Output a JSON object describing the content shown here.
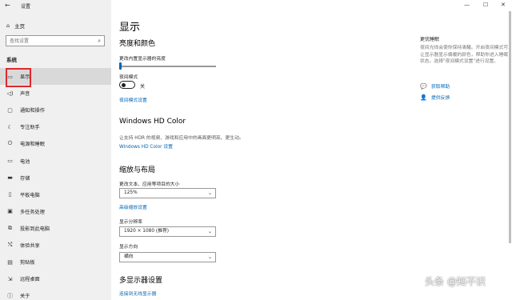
{
  "window": {
    "title": "设置",
    "back_icon": "arrow-left-icon",
    "controls": [
      "—",
      "☐",
      "✕"
    ]
  },
  "sidebar": {
    "home_label": "主页",
    "search_placeholder": "查找设置",
    "section": "系统",
    "items": [
      {
        "label": "显示",
        "icon": "monitor-icon",
        "active": true
      },
      {
        "label": "声音",
        "icon": "speaker-icon"
      },
      {
        "label": "通知和操作",
        "icon": "notification-icon"
      },
      {
        "label": "专注助手",
        "icon": "moon-icon"
      },
      {
        "label": "电源和睡眠",
        "icon": "power-icon"
      },
      {
        "label": "电池",
        "icon": "battery-icon"
      },
      {
        "label": "存储",
        "icon": "storage-icon"
      },
      {
        "label": "平板电脑",
        "icon": "tablet-icon"
      },
      {
        "label": "多任务处理",
        "icon": "multitask-icon"
      },
      {
        "label": "投影到此电脑",
        "icon": "project-icon"
      },
      {
        "label": "体验共享",
        "icon": "share-icon"
      },
      {
        "label": "剪贴板",
        "icon": "clipboard-icon"
      },
      {
        "label": "远程桌面",
        "icon": "remote-desktop-icon"
      },
      {
        "label": "关于",
        "icon": "info-icon"
      }
    ]
  },
  "main": {
    "title": "显示",
    "brightness": {
      "heading": "亮度和颜色",
      "slider_label": "更改内置显示器的亮度",
      "slider_level": 0.0,
      "night_light_label": "夜间模式",
      "night_light_state": "关",
      "night_light_link": "夜间模式设置"
    },
    "hdr": {
      "heading": "Windows HD Color",
      "desc": "让支持 HDR 的视频、游戏和应用中的画面更明亮、更生动。",
      "link": "Windows HD Color 设置"
    },
    "scale": {
      "heading": "缩放与布局",
      "text_size_label": "更改文本、应用等项目的大小",
      "text_size_value": "125%",
      "advanced_link": "高级缩放设置",
      "resolution_label": "显示分辨率",
      "resolution_value": "1920 × 1080 (推荐)",
      "orientation_label": "显示方向",
      "orientation_value": "横向"
    },
    "multi": {
      "heading": "多显示器设置",
      "link": "连接到无线显示器"
    }
  },
  "right": {
    "title": "更优睡眠",
    "text": "夜间光线会使你保持清醒。开启夜间模式可让显示器显示偏暖的颜色，帮助你进入睡眠状态。选择\"夜间模式设置\"进行设置。",
    "help_link": "获取帮助",
    "feedback_link": "提供反馈"
  },
  "watermark": "头条 @知不识",
  "colors": {
    "accent": "#0066b4",
    "highlight": "#e0282c"
  }
}
